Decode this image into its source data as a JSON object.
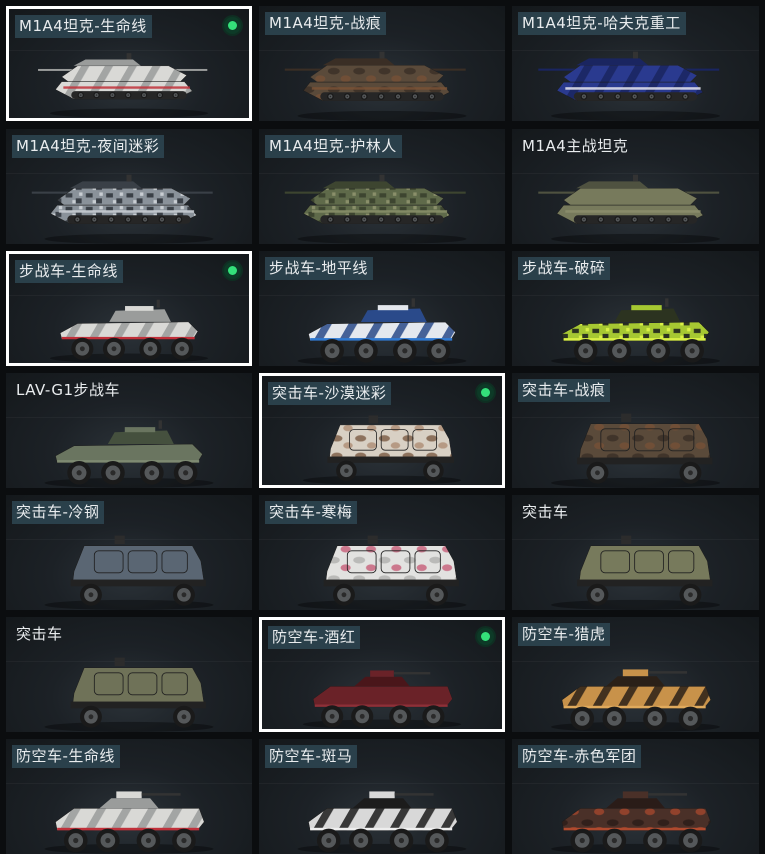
{
  "colors": {
    "selected_border": "#ffffff",
    "equipped": "#34e07a",
    "label_bg": "#2e4652"
  },
  "items": [
    {
      "label": "M1A4坦克-生命线",
      "type": "tank",
      "scheme": "lifeline",
      "selected": true,
      "equipped": true,
      "tag": true
    },
    {
      "label": "M1A4坦克-战痕",
      "type": "tank",
      "scheme": "rust",
      "selected": false,
      "equipped": false,
      "tag": true
    },
    {
      "label": "M1A4坦克-哈夫克重工",
      "type": "tank",
      "scheme": "haavk",
      "selected": false,
      "equipped": false,
      "tag": true
    },
    {
      "label": "M1A4坦克-夜间迷彩",
      "type": "tank",
      "scheme": "nightcamo",
      "selected": false,
      "equipped": false,
      "tag": true
    },
    {
      "label": "M1A4坦克-护林人",
      "type": "tank",
      "scheme": "forest",
      "selected": false,
      "equipped": false,
      "tag": true
    },
    {
      "label": "M1A4主战坦克",
      "type": "tank",
      "scheme": "olive",
      "selected": false,
      "equipped": false,
      "tag": false
    },
    {
      "label": "步战车-生命线",
      "type": "ifv",
      "scheme": "lifeline",
      "selected": true,
      "equipped": true,
      "tag": true
    },
    {
      "label": "步战车-地平线",
      "type": "ifv",
      "scheme": "horizon",
      "selected": false,
      "equipped": false,
      "tag": true
    },
    {
      "label": "步战车-破碎",
      "type": "ifv",
      "scheme": "shatter",
      "selected": false,
      "equipped": false,
      "tag": true
    },
    {
      "label": "LAV-G1步战车",
      "type": "ifv",
      "scheme": "green",
      "selected": false,
      "equipped": false,
      "tag": false
    },
    {
      "label": "突击车-沙漠迷彩",
      "type": "assault",
      "scheme": "desertcamo",
      "selected": true,
      "equipped": true,
      "tag": true
    },
    {
      "label": "突击车-战痕",
      "type": "assault",
      "scheme": "rust",
      "selected": false,
      "equipped": false,
      "tag": true
    },
    {
      "label": "突击车-冷钢",
      "type": "assault",
      "scheme": "coldsteel",
      "selected": false,
      "equipped": false,
      "tag": true
    },
    {
      "label": "突击车-寒梅",
      "type": "assault",
      "scheme": "plum",
      "selected": false,
      "equipped": false,
      "tag": true
    },
    {
      "label": "突击车",
      "type": "assault",
      "scheme": "olive",
      "selected": false,
      "equipped": false,
      "tag": false
    },
    {
      "label": "突击车",
      "type": "assault",
      "scheme": "olive2",
      "selected": false,
      "equipped": false,
      "tag": false
    },
    {
      "label": "防空车-酒红",
      "type": "aa",
      "scheme": "wine",
      "selected": true,
      "equipped": true,
      "tag": true
    },
    {
      "label": "防空车-猎虎",
      "type": "aa",
      "scheme": "tiger",
      "selected": false,
      "equipped": false,
      "tag": true
    },
    {
      "label": "防空车-生命线",
      "type": "aa",
      "scheme": "lifeline",
      "selected": false,
      "equipped": false,
      "tag": true
    },
    {
      "label": "防空车-斑马",
      "type": "aa",
      "scheme": "zebra",
      "selected": false,
      "equipped": false,
      "tag": true
    },
    {
      "label": "防空车-赤色军团",
      "type": "aa",
      "scheme": "redlegion",
      "selected": false,
      "equipped": false,
      "tag": true
    }
  ]
}
